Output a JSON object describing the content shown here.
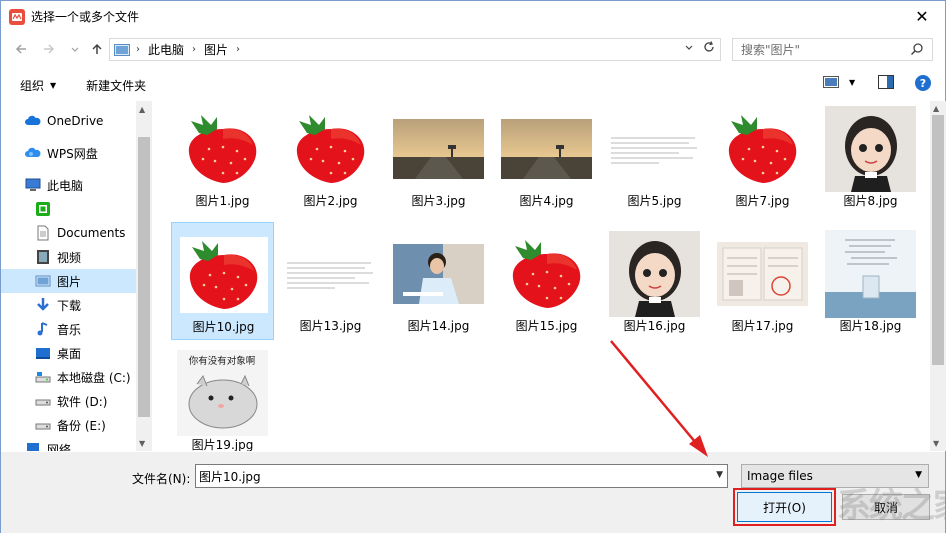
{
  "window": {
    "title": "选择一个或多个文件",
    "close": "✕"
  },
  "address": {
    "segments": [
      "此电脑",
      "图片"
    ],
    "search_placeholder": "搜索\"图片\""
  },
  "toolbar": {
    "organize": "组织",
    "new_folder": "新建文件夹"
  },
  "sidebar": {
    "items": [
      {
        "label": "OneDrive",
        "icon": "cloud-icon"
      },
      {
        "label": "WPS网盘",
        "icon": "wps-cloud-icon"
      },
      {
        "label": "此电脑",
        "icon": "computer-icon"
      },
      {
        "label": "",
        "icon": "green-app-icon"
      },
      {
        "label": "Documents",
        "icon": "document-icon"
      },
      {
        "label": "视频",
        "icon": "video-icon"
      },
      {
        "label": "图片",
        "icon": "pictures-icon"
      },
      {
        "label": "下载",
        "icon": "download-icon"
      },
      {
        "label": "音乐",
        "icon": "music-icon"
      },
      {
        "label": "桌面",
        "icon": "desktop-icon"
      },
      {
        "label": "本地磁盘 (C:)",
        "icon": "drive-icon"
      },
      {
        "label": "软件 (D:)",
        "icon": "drive-icon"
      },
      {
        "label": "备份 (E:)",
        "icon": "drive-icon"
      },
      {
        "label": "网络",
        "icon": "network-icon"
      }
    ]
  },
  "files": [
    {
      "name": "图片1.jpg",
      "kind": "strawberry"
    },
    {
      "name": "图片2.jpg",
      "kind": "strawberry"
    },
    {
      "name": "图片3.jpg",
      "kind": "road"
    },
    {
      "name": "图片4.jpg",
      "kind": "road"
    },
    {
      "name": "图片5.jpg",
      "kind": "text"
    },
    {
      "name": "图片7.jpg",
      "kind": "strawberry"
    },
    {
      "name": "图片8.jpg",
      "kind": "girl"
    },
    {
      "name": "图片10.jpg",
      "kind": "strawberry"
    },
    {
      "name": "图片13.jpg",
      "kind": "text"
    },
    {
      "name": "图片14.jpg",
      "kind": "boy"
    },
    {
      "name": "图片15.jpg",
      "kind": "strawberry"
    },
    {
      "name": "图片16.jpg",
      "kind": "girl"
    },
    {
      "name": "图片17.jpg",
      "kind": "certificate"
    },
    {
      "name": "图片18.jpg",
      "kind": "glass"
    },
    {
      "name": "图片19.jpg",
      "kind": "hamster",
      "caption": "你有没有对象啊"
    }
  ],
  "bottom": {
    "filename_label": "文件名(N):",
    "filename_value": "图片10.jpg",
    "filetype": "Image files",
    "open": "打开(O)",
    "cancel": "取消"
  },
  "watermark": "系统之家",
  "colors": {
    "selection": "#cce8ff",
    "accent": "#0078d7",
    "highlight": "#e02020"
  }
}
